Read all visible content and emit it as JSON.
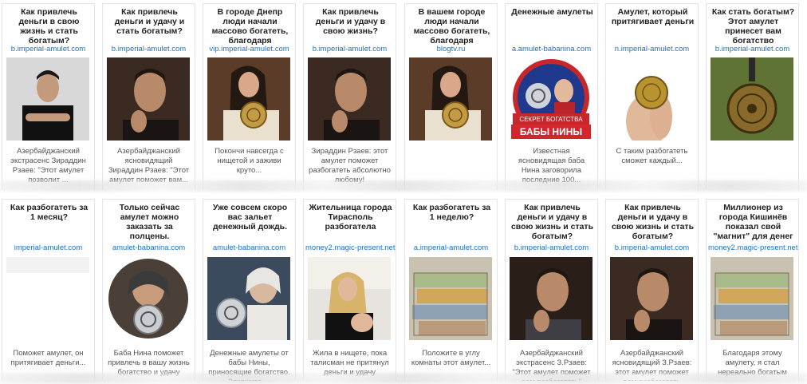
{
  "cards": [
    {
      "title": "Как привлечь деньги в свою жизнь и стать богатым?",
      "domain": "b.imperial-amulet.com",
      "desc": "Азербайджанский экстрасенс Зираддин Рзаев: \"Этот амулет позволит ...",
      "image": "man-arms-crossed"
    },
    {
      "title": "Как привлечь деньги и удачу и стать богатым?",
      "domain": "b.imperial-amulet.com",
      "desc": "Азербайджанский ясновидящий Зираддин Рзаев: \"Этот амулет поможет вам...",
      "image": "man-portrait"
    },
    {
      "title": "В городе Днепр люди начали массово богатеть, благодаря",
      "domain": "vip.imperial-amulet.com",
      "desc": "Покончи навсегда с нищетой и заживи круто...",
      "image": "woman-amulet"
    },
    {
      "title": "Как привлечь деньги и удачу в свою жизнь?",
      "domain": "b.imperial-amulet.com",
      "desc": "Зираддин Рзаев: этот амулет поможет разбогатеть абсолютно любому!",
      "image": "man-portrait"
    },
    {
      "title": "В вашем городе люди начали массово богатеть, благодаря",
      "domain": "blogtv.ru",
      "desc": "",
      "image": "woman-amulet"
    },
    {
      "title": "Денежные амулеты",
      "domain": "a.amulet-babanina.com",
      "desc": "Известная ясновидящая баба Нина заговорила последние 100...",
      "image": "baba-nina-badge"
    },
    {
      "title": "Амулет, который притягивает деньги",
      "domain": "n.imperial-amulet.com",
      "desc": "С таким разбогатеть сможет каждый...",
      "image": "coin-fingers"
    },
    {
      "title": "Как стать богатым? Этот амулет принесет вам богатство",
      "domain": "b.imperial-amulet.com",
      "desc": "",
      "image": "amulet-grass"
    },
    {
      "title": "Как разбогатеть за 1 месяц?",
      "domain": "imperial-amulet.com",
      "desc": "Поможет амулет, он притягивает деньги...",
      "image": "blank"
    },
    {
      "title": "Только сейчас амулет можно заказать за полцены.",
      "domain": "amulet-babanina.com",
      "desc": "Баба Нина поможет привлечь в вашу жизнь богатство и удачу",
      "image": "grandma-round"
    },
    {
      "title": "Уже совсем скоро вас зальет денежный дождь.",
      "domain": "amulet-babanina.com",
      "desc": "Денежные амулеты от бабы Нины, приносящие богатство. Закажите ...",
      "image": "grandma-amulet"
    },
    {
      "title": "Жительница города Тирасполь разбогатела",
      "domain": "money2.magic-present.net",
      "desc": "Жила в нищете, пока талисман не притянул деньги и удачу",
      "image": "woman-jet"
    },
    {
      "title": "Как разбогатеть за 1 неделю?",
      "domain": "a.imperial-amulet.com",
      "desc": "Положите в углу комнаты этот амулет...",
      "image": "money-stacks"
    },
    {
      "title": "Как привлечь деньги и удачу в свою жизнь и стать богатым?",
      "domain": "b.imperial-amulet.com",
      "desc": "Азербайджанский экстрасенс З.Рзаев: \"Этот амулет поможет вам разбогатеть\"",
      "image": "man-suit"
    },
    {
      "title": "Как привлечь деньги и удачу в свою жизнь и стать богатым?",
      "domain": "b.imperial-amulet.com",
      "desc": "Азербайджанский ясновидящий З.Рзаев: этот амулет поможет вам разбогатеть",
      "image": "man-portrait"
    },
    {
      "title": "Миллионер из города Кишинёв показал свой \"магнит\" для денег",
      "domain": "money2.magic-present.net",
      "desc": "Благодаря этому амулету, я стал нереально богатым",
      "image": "money-stacks"
    }
  ],
  "badge": {
    "top": "СЕКРЕТ БОГАТСТВА",
    "bottom": "БАБЫ НИНЫ"
  }
}
